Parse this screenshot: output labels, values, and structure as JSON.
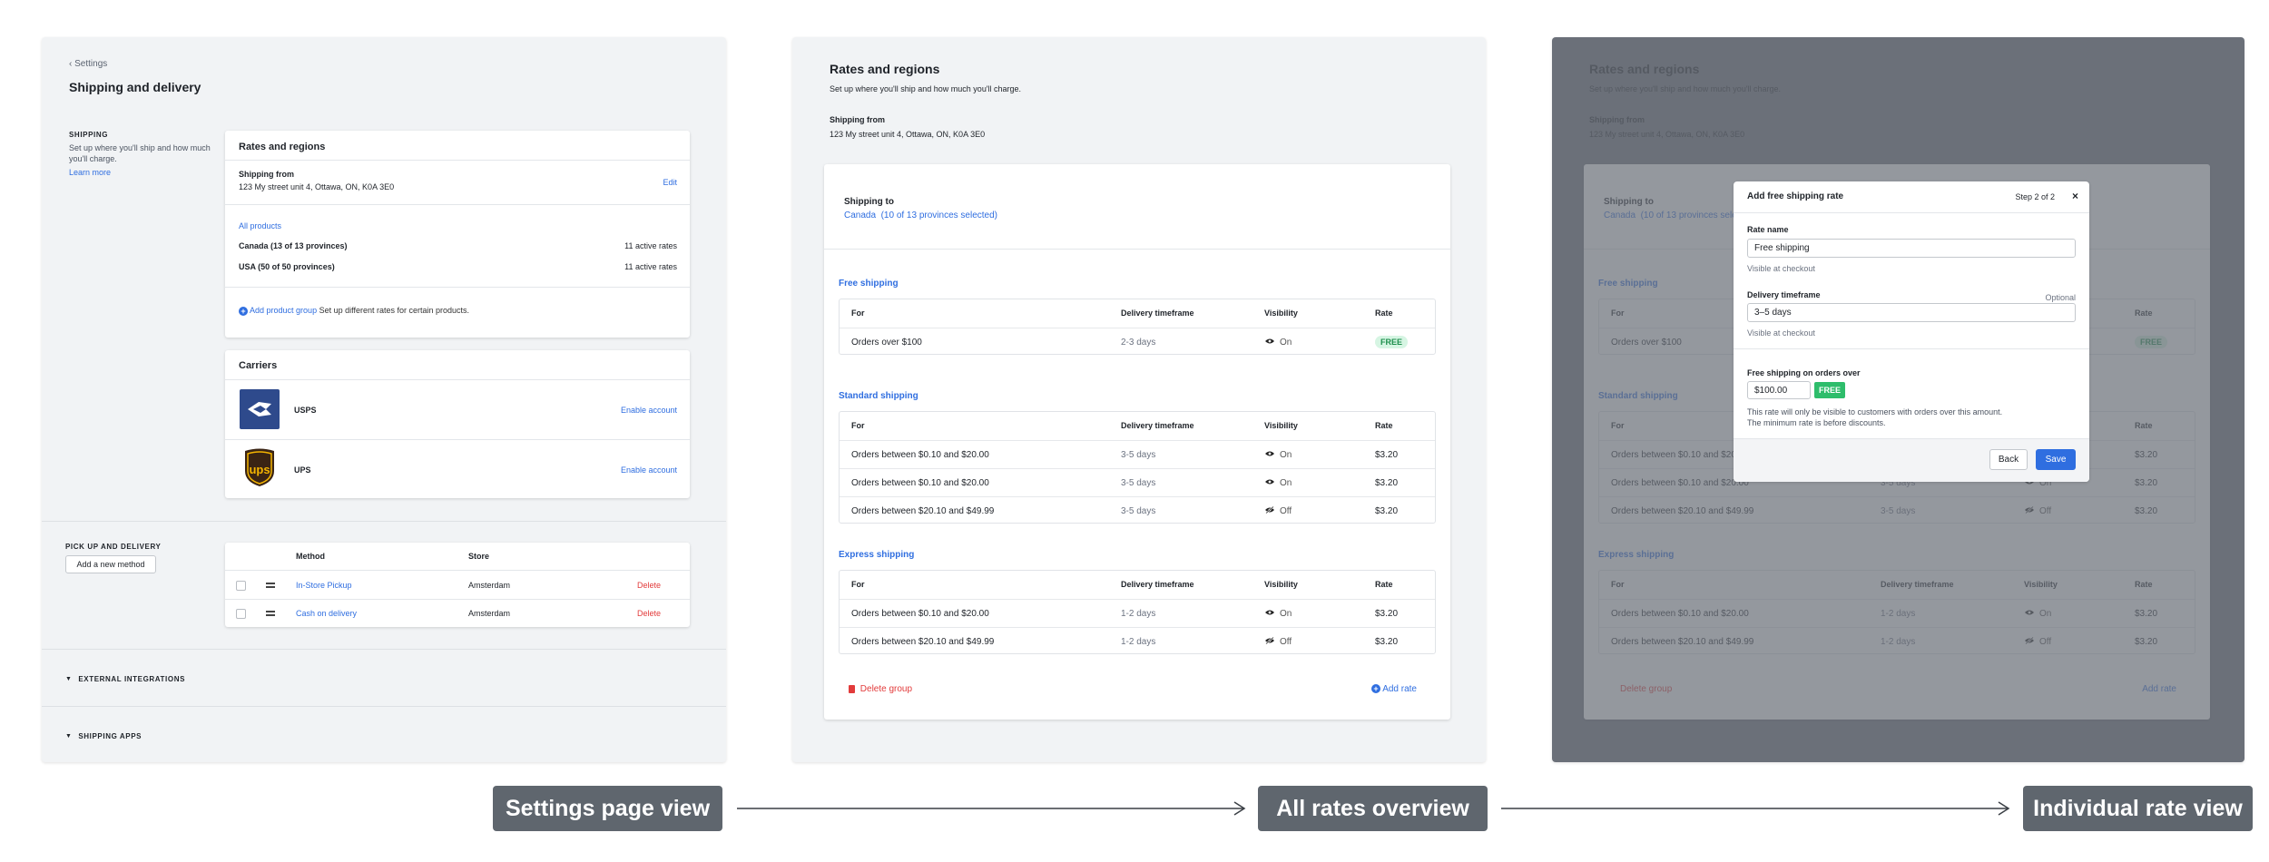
{
  "settings_view": {
    "back_label": "Settings",
    "page_title": "Shipping and delivery",
    "shipping": {
      "heading": "SHIPPING",
      "description": "Set up where you'll ship and how much you'll charge.",
      "learn_more": "Learn more"
    },
    "rates_card": {
      "title": "Rates and regions",
      "shipping_from_label": "Shipping from",
      "address": "123 My street unit 4, Ottawa, ON, K0A 3E0",
      "edit": "Edit",
      "all_products": "All products",
      "regions": [
        {
          "name": "Canada (13 of 13 provinces)",
          "rates": "11 active rates"
        },
        {
          "name": "USA (50 of 50 provinces)",
          "rates": "11 active rates"
        }
      ],
      "add_group": "Add product group",
      "add_group_hint": "Set up different rates for certain products."
    },
    "carriers_card": {
      "title": "Carriers",
      "items": [
        {
          "name": "USPS",
          "action": "Enable account",
          "logo_text": "USPS"
        },
        {
          "name": "UPS",
          "action": "Enable account",
          "logo_text": "ups"
        }
      ]
    },
    "pickup": {
      "heading": "PICK UP AND DELIVERY",
      "add_button": "Add a new method",
      "columns": [
        "Method",
        "Store"
      ],
      "rows": [
        {
          "method": "In-Store Pickup",
          "store": "Amsterdam",
          "action": "Delete"
        },
        {
          "method": "Cash on delivery",
          "store": "Amsterdam",
          "action": "Delete"
        }
      ]
    },
    "external_integrations": "EXTERNAL INTEGRATIONS",
    "shipping_apps": "SHIPPING APPS"
  },
  "rates_view": {
    "title": "Rates and regions",
    "subtitle": "Set up where you'll ship and how much you'll charge.",
    "shipping_from_label": "Shipping from",
    "address": "123 My street unit 4, Ottawa, ON, K0A 3E0",
    "shipping_to_label": "Shipping to",
    "shipping_to_value": "Canada  (10 of 13 provinces selected)",
    "columns": [
      "For",
      "Delivery timeframe",
      "Visibility",
      "Rate"
    ],
    "groups": [
      {
        "name": "Free shipping",
        "rows": [
          {
            "for": "Orders over $100",
            "time": "2-3 days",
            "vis": "On",
            "rate": "FREE"
          }
        ]
      },
      {
        "name": "Standard shipping",
        "rows": [
          {
            "for": "Orders  between $0.10 and $20.00",
            "time": "3-5 days",
            "vis": "On",
            "rate": "$3.20"
          },
          {
            "for": "Orders  between $0.10 and $20.00",
            "time": "3-5 days",
            "vis": "On",
            "rate": "$3.20"
          },
          {
            "for": "Orders  between $20.10 and $49.99",
            "time": "3-5 days",
            "vis": "Off",
            "rate": "$3.20"
          }
        ]
      },
      {
        "name": "Express shipping",
        "rows": [
          {
            "for": "Orders  between $0.10 and $20.00",
            "time": "1-2 days",
            "vis": "On",
            "rate": "$3.20"
          },
          {
            "for": "Orders  between $20.10 and $49.99",
            "time": "1-2 days",
            "vis": "Off",
            "rate": "$3.20"
          }
        ]
      }
    ],
    "delete_group": "Delete group",
    "add_rate": "Add rate"
  },
  "modal": {
    "title": "Add free shipping rate",
    "step": "Step 2 of 2",
    "rate_name_label": "Rate name",
    "rate_name_value": "Free shipping",
    "rate_name_hint": "Visible at checkout",
    "timeframe_label": "Delivery timeframe",
    "timeframe_optional": "Optional",
    "timeframe_value": "3–5 days",
    "timeframe_hint": "Visible at checkout",
    "threshold_label": "Free shipping on orders over",
    "threshold_value": "$100.00",
    "threshold_badge": "FREE",
    "threshold_note": "This rate will only be visible to customers with orders over this amount.",
    "threshold_note2": "The minimum rate is before discounts.",
    "back": "Back",
    "save": "Save"
  },
  "flow_labels": {
    "settings": "Settings page view",
    "overview": "All rates overview",
    "individual": "Individual rate view"
  },
  "colors": {
    "accent": "#2f6ee0",
    "danger": "#e23b3b",
    "free_badge": "#2ebd6b",
    "overlay": "#6b7079",
    "label_bg": "#5f666e"
  }
}
